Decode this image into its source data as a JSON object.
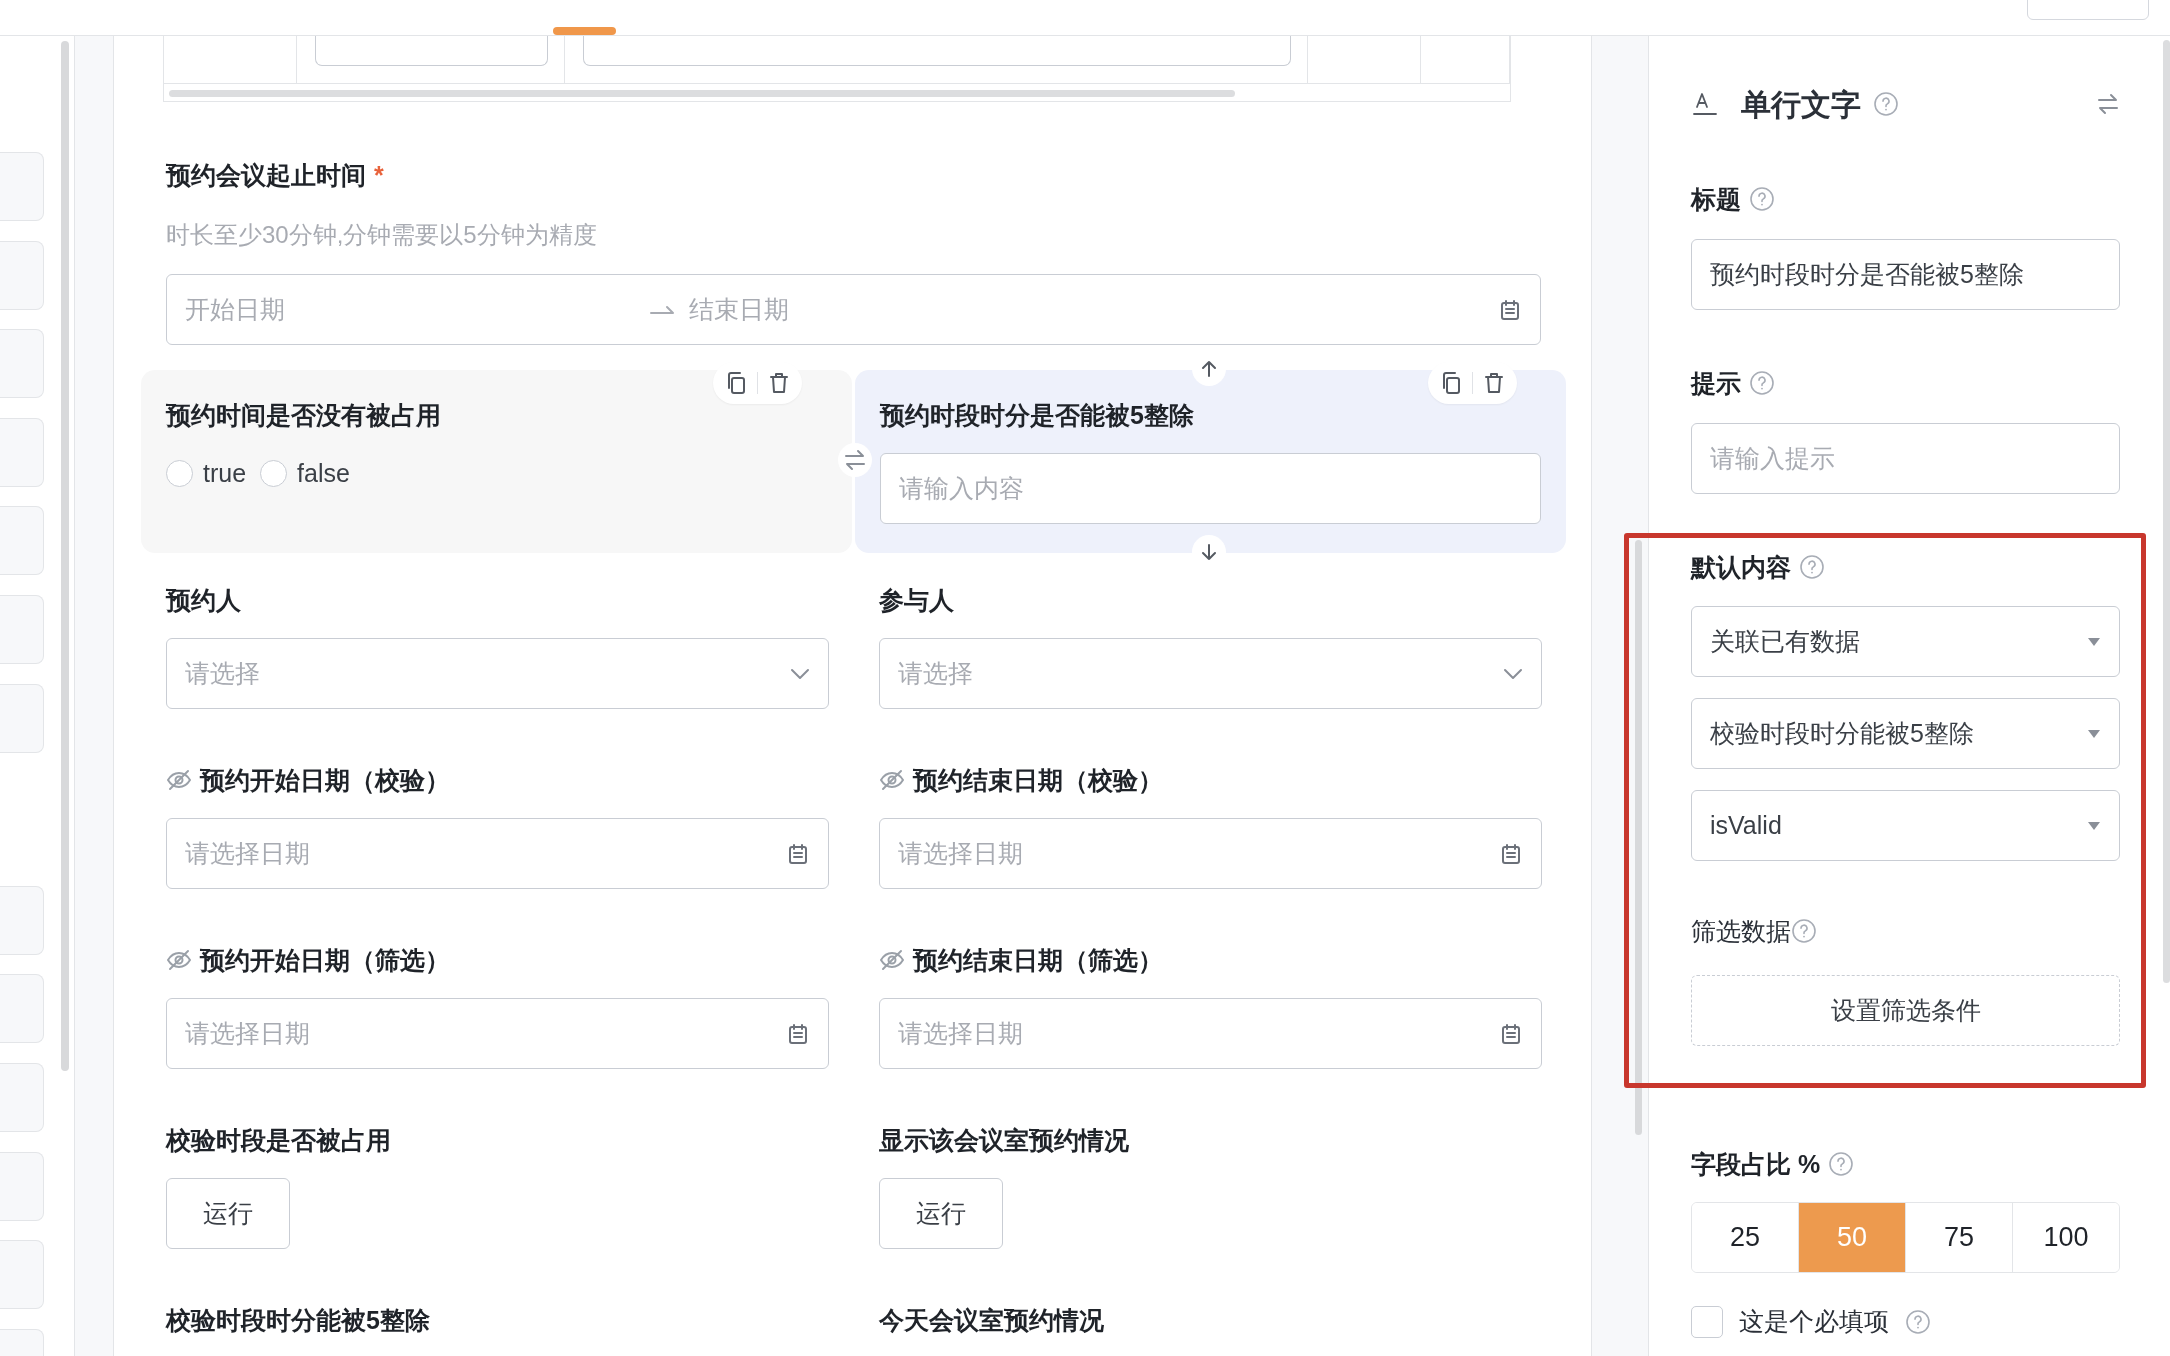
{
  "form": {
    "date_range": {
      "label": "预约会议起止时间",
      "required_mark": "*",
      "hint": "时长至少30分钟,分钟需要以5分钟为精度",
      "start_placeholder": "开始日期",
      "end_placeholder": "结束日期"
    },
    "cards": [
      {
        "kind": "radio",
        "label": "预约时间是否没有被占用",
        "selected": false,
        "options": [
          {
            "label": "true",
            "checked": false
          },
          {
            "label": "false",
            "checked": false
          }
        ]
      },
      {
        "kind": "text",
        "label": "预约时段时分是否能被5整除",
        "selected": true,
        "placeholder": "请输入内容"
      }
    ],
    "fields": [
      {
        "kind": "select",
        "label": "预约人",
        "hidden": false,
        "placeholder": "请选择"
      },
      {
        "kind": "select",
        "label": "参与人",
        "hidden": false,
        "placeholder": "请选择"
      },
      {
        "kind": "date",
        "label": "预约开始日期（校验）",
        "hidden": true,
        "placeholder": "请选择日期"
      },
      {
        "kind": "date",
        "label": "预约结束日期（校验）",
        "hidden": true,
        "placeholder": "请选择日期"
      },
      {
        "kind": "date",
        "label": "预约开始日期（筛选）",
        "hidden": true,
        "placeholder": "请选择日期"
      },
      {
        "kind": "date",
        "label": "预约结束日期（筛选）",
        "hidden": true,
        "placeholder": "请选择日期"
      },
      {
        "kind": "button",
        "label": "校验时段是否被占用",
        "hidden": false,
        "button": "运行"
      },
      {
        "kind": "button",
        "label": "显示该会议室预约情况",
        "hidden": false,
        "button": "运行"
      },
      {
        "kind": "title",
        "label": "校验时段时分能被5整除",
        "hidden": false
      },
      {
        "kind": "title",
        "label": "今天会议室预约情况",
        "hidden": false
      }
    ]
  },
  "panel": {
    "title": "单行文字",
    "title_field": {
      "label": "标题",
      "value": "预约时段时分是否能被5整除"
    },
    "hint_field": {
      "label": "提示",
      "placeholder": "请输入提示"
    },
    "default_content": {
      "label": "默认内容",
      "highlighted": true,
      "selects": [
        "关联已有数据",
        "校验时段时分能被5整除",
        "isValid"
      ],
      "filter_label": "筛选数据",
      "filter_button": "设置筛选条件"
    },
    "width_ratio": {
      "label": "字段占比 %",
      "options": [
        {
          "label": "25",
          "selected": false
        },
        {
          "label": "50",
          "selected": true
        },
        {
          "label": "75",
          "selected": false
        },
        {
          "label": "100",
          "selected": false
        }
      ]
    },
    "required": {
      "label": "这是个必填项",
      "checked": false
    }
  }
}
